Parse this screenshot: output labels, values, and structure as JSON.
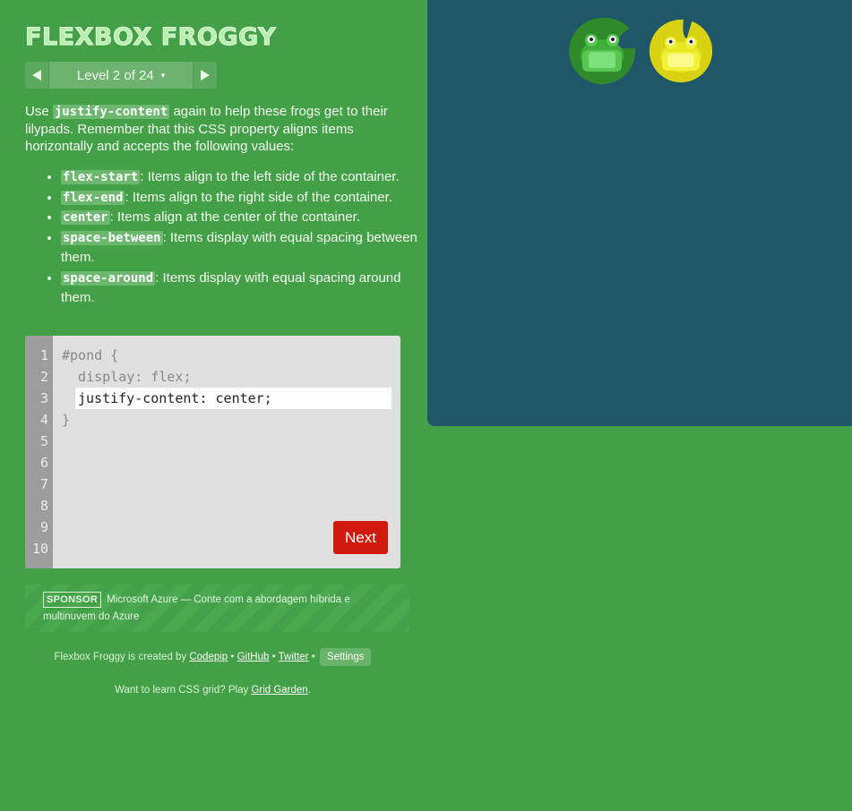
{
  "title": "FLEXBOX FROGGY",
  "level": {
    "text": "Level 2 of 24",
    "caret": "▾"
  },
  "instructions": {
    "before": "Use ",
    "keyword": "justify-content",
    "after": " again to help these frogs get to their lilypads. Remember that this CSS property aligns items horizontally and accepts the following values:"
  },
  "values": [
    {
      "code": "flex-start",
      "desc": ": Items align to the left side of the container."
    },
    {
      "code": "flex-end",
      "desc": ": Items align to the right side of the container."
    },
    {
      "code": "center",
      "desc": ": Items align at the center of the container."
    },
    {
      "code": "space-between",
      "desc": ": Items display with equal spacing between them."
    },
    {
      "code": "space-around",
      "desc": ": Items display with equal spacing around them."
    }
  ],
  "editor": {
    "line_numbers": [
      "1",
      "2",
      "3",
      "4",
      "5",
      "6",
      "7",
      "8",
      "9",
      "10"
    ],
    "line1": "#pond {",
    "line2": "  display: flex;",
    "input": "justify-content: center;",
    "line4": "}",
    "next_label": "Next"
  },
  "sponsor": {
    "tag": "SPONSOR",
    "text": "Microsoft Azure — Conte com a abordagem híbrida e multinuvem do Azure"
  },
  "footer": {
    "created_by": "Flexbox Froggy is created by ",
    "codepip": "Codepip",
    "sep": " • ",
    "github": "GitHub",
    "twitter": "Twitter",
    "settings": "Settings",
    "learn_prefix": "Want to learn CSS grid? Play ",
    "grid_garden": "Grid Garden",
    "learn_suffix": "."
  },
  "pond": {
    "frogs": [
      {
        "color": "green",
        "hex": "#57c84e"
      },
      {
        "color": "yellow",
        "hex": "#e8e82a"
      }
    ]
  },
  "colors": {
    "background": "#43a047",
    "pond": "#1f5768",
    "next_button": "#d01a0e"
  }
}
